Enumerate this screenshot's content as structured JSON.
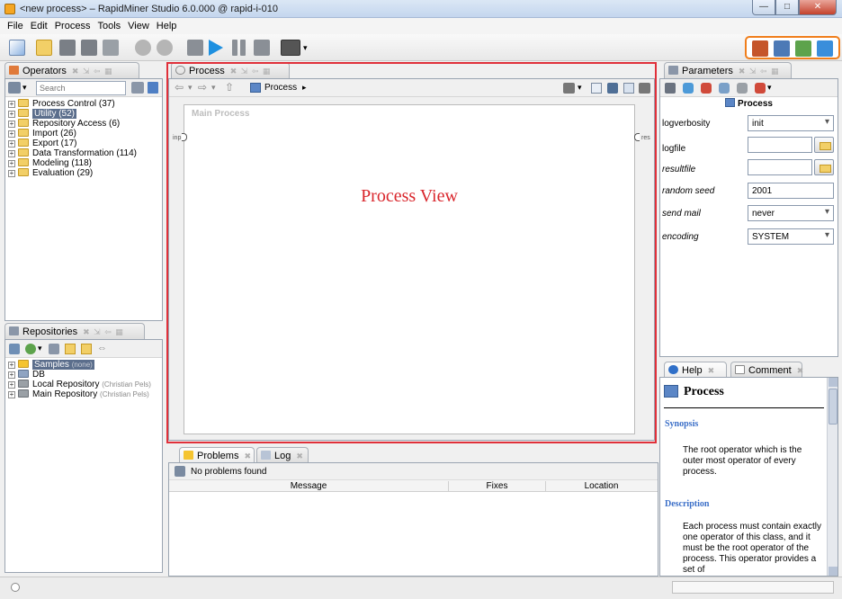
{
  "window": {
    "title": "<new process> – RapidMiner Studio 6.0.000 @ rapid-i-010"
  },
  "menu": {
    "items": [
      "File",
      "Edit",
      "Process",
      "Tools",
      "View",
      "Help"
    ]
  },
  "operators": {
    "tab_label": "Operators",
    "search_placeholder": "Search",
    "tree": [
      {
        "label": "Process Control (37)",
        "selected": false
      },
      {
        "label": "Utility (52)",
        "selected": true
      },
      {
        "label": "Repository Access (6)",
        "selected": false
      },
      {
        "label": "Import (26)",
        "selected": false
      },
      {
        "label": "Export (17)",
        "selected": false
      },
      {
        "label": "Data Transformation (114)",
        "selected": false
      },
      {
        "label": "Modeling (118)",
        "selected": false
      },
      {
        "label": "Evaluation (29)",
        "selected": false
      }
    ]
  },
  "repositories": {
    "tab_label": "Repositories",
    "items": [
      {
        "label": "Samples",
        "suffix": "(none)",
        "selected": true
      },
      {
        "label": "DB",
        "suffix": ""
      },
      {
        "label": "Local Repository",
        "suffix": "(Christian Pels)"
      },
      {
        "label": "Main Repository",
        "suffix": "(Christian Pels)"
      }
    ]
  },
  "process": {
    "tab_label": "Process",
    "breadcrumb": "Process",
    "canvas_label": "Main Process",
    "annotation": "Process View",
    "port_in": "inp",
    "port_out": "res"
  },
  "parameters": {
    "tab_label": "Parameters",
    "title": "Process",
    "rows": [
      {
        "label": "logverbosity",
        "value": "init",
        "type": "select",
        "italic": false
      },
      {
        "label": "logfile",
        "value": "",
        "type": "file",
        "italic": false
      },
      {
        "label": "resultfile",
        "value": "",
        "type": "file",
        "italic": true
      },
      {
        "label": "random seed",
        "value": "2001",
        "type": "text",
        "italic": true
      },
      {
        "label": "send mail",
        "value": "never",
        "type": "select",
        "italic": true
      },
      {
        "label": "encoding",
        "value": "SYSTEM",
        "type": "select",
        "italic": true
      }
    ]
  },
  "help": {
    "tab_help": "Help",
    "tab_comment": "Comment",
    "title": "Process",
    "synopsis_heading": "Synopsis",
    "synopsis": "The root operator which is the outer most operator of every process.",
    "description_heading": "Description",
    "description": "Each process must contain exactly one operator of this class, and it must be the root operator of the process. This operator provides a set of"
  },
  "problems": {
    "tab_problems": "Problems",
    "tab_log": "Log",
    "status": "No problems found",
    "columns": [
      "Message",
      "Fixes",
      "Location"
    ]
  },
  "colors": {
    "highlight": "#e0303a",
    "perspective_border": "#f07e1b",
    "help_heading": "#3b6fc8"
  }
}
